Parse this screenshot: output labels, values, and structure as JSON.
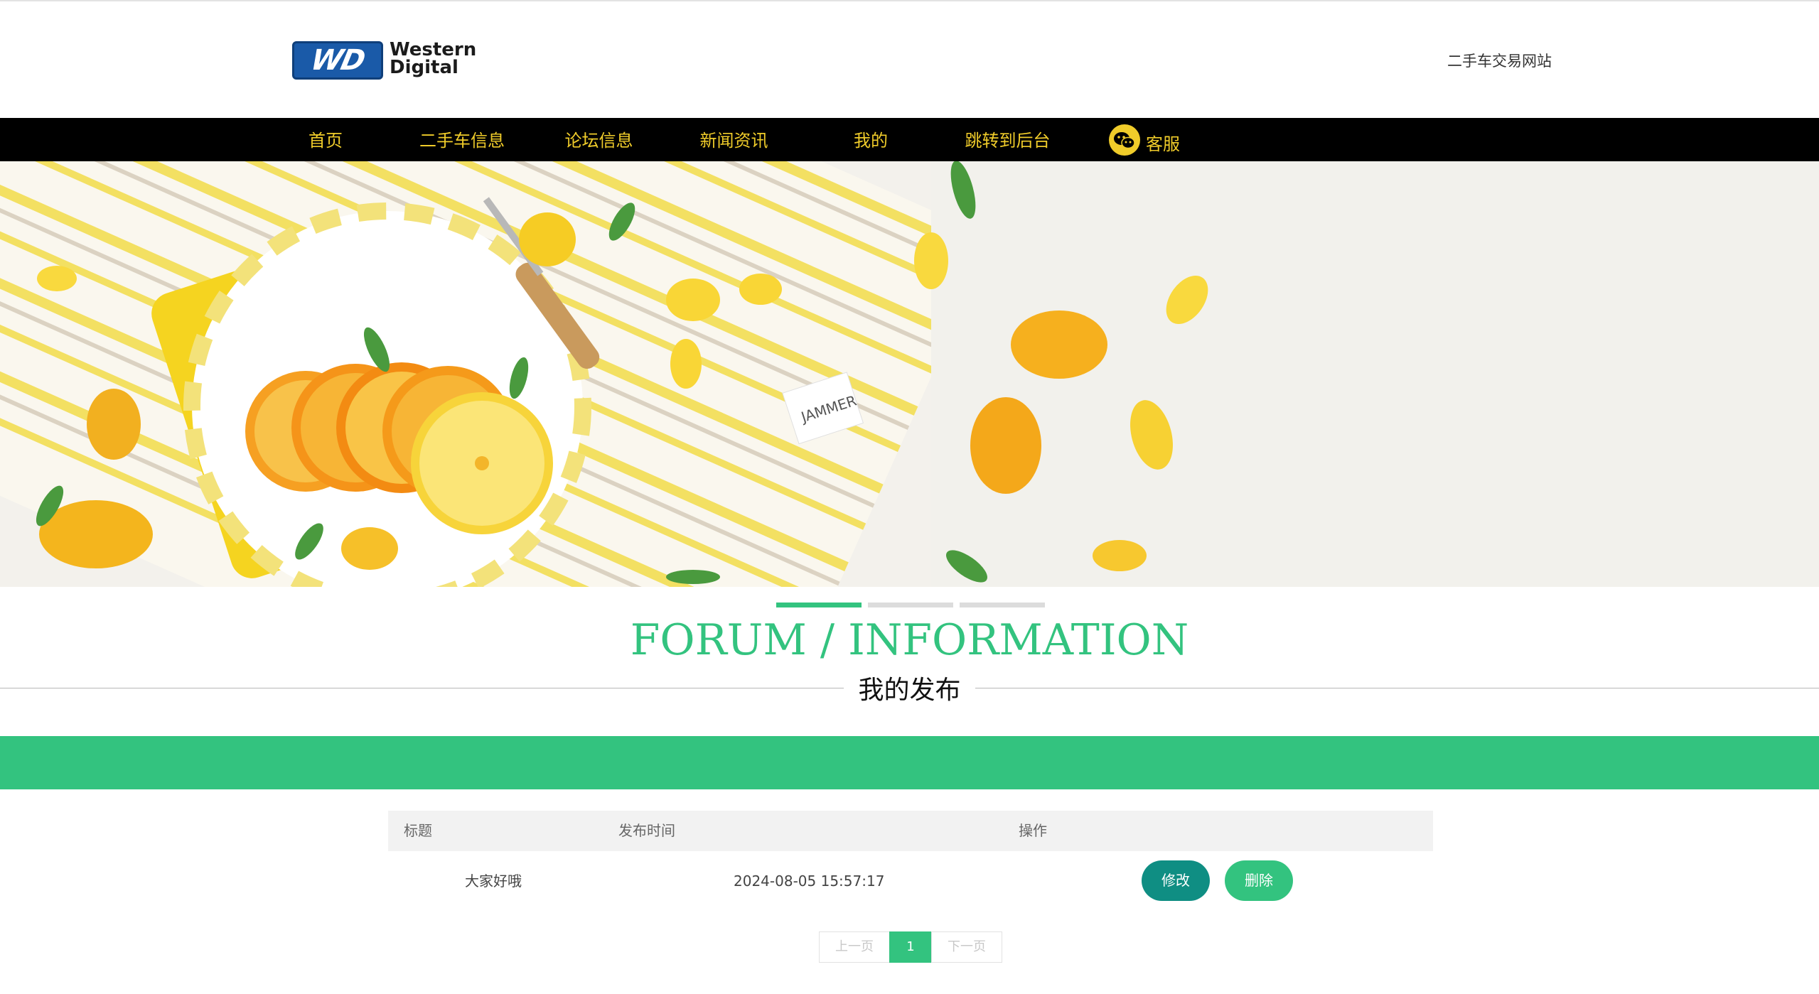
{
  "header": {
    "logo_mark": "WD",
    "logo_line1": "Western",
    "logo_line2": "Digital",
    "site_name": "二手车交易网站"
  },
  "nav": {
    "items": [
      "首页",
      "二手车信息",
      "论坛信息",
      "新闻资讯",
      "我的",
      "跳转到后台"
    ],
    "service_label": "客服"
  },
  "banner": {
    "tag_text": "JAMMER",
    "active_slide": 1,
    "slide_count": 3
  },
  "section": {
    "title_en": "FORUM / INFORMATION",
    "title_cn": "我的发布"
  },
  "table": {
    "headers": [
      "标题",
      "发布时间",
      "操作"
    ],
    "rows": [
      {
        "title": "大家好哦",
        "time": "2024-08-05 15:57:17",
        "edit_label": "修改",
        "delete_label": "删除"
      }
    ]
  },
  "pagination": {
    "prev_label": "上一页",
    "current_page": "1",
    "next_label": "下一页"
  },
  "colors": {
    "accent": "#33c37f",
    "nav_bg": "#000000",
    "nav_text": "#f0cc2a",
    "edit_button": "#0f8e83"
  }
}
